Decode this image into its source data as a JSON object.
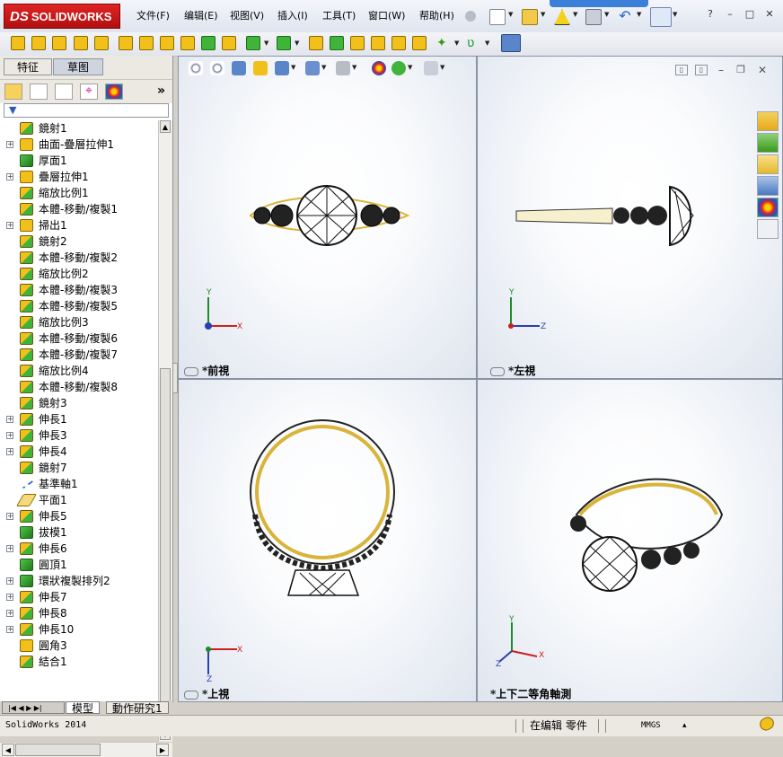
{
  "app": {
    "logo_prefix": "DS",
    "logo_text": "SOLIDWORKS",
    "menu": [
      "文件(F)",
      "编辑(E)",
      "视图(V)",
      "插入(I)",
      "工具(T)",
      "窗口(W)",
      "帮助(H)"
    ],
    "window_controls": [
      "?",
      "–",
      "□",
      "✕"
    ]
  },
  "feature_manager": {
    "tabs": [
      "特征",
      "草图"
    ],
    "active_tab": "草图",
    "more_label": "»",
    "items": [
      {
        "label": "鏡射1",
        "icon": "mirror-icon",
        "expandable": false
      },
      {
        "label": "曲面-疊層拉伸1",
        "icon": "loft-surface-icon",
        "expandable": true
      },
      {
        "label": "厚面1",
        "icon": "thicken-icon",
        "expandable": false
      },
      {
        "label": "疊層拉伸1",
        "icon": "loft-icon",
        "expandable": true
      },
      {
        "label": "縮放比例1",
        "icon": "scale-icon",
        "expandable": false
      },
      {
        "label": "本體-移動/複製1",
        "icon": "move-body-icon",
        "expandable": false
      },
      {
        "label": "掃出1",
        "icon": "sweep-icon",
        "expandable": true
      },
      {
        "label": "鏡射2",
        "icon": "mirror-icon",
        "expandable": false
      },
      {
        "label": "本體-移動/複製2",
        "icon": "move-body-icon",
        "expandable": false
      },
      {
        "label": "縮放比例2",
        "icon": "scale-icon",
        "expandable": false
      },
      {
        "label": "本體-移動/複製3",
        "icon": "move-body-icon",
        "expandable": false
      },
      {
        "label": "本體-移動/複製5",
        "icon": "move-body-icon",
        "expandable": false
      },
      {
        "label": "縮放比例3",
        "icon": "scale-icon",
        "expandable": false
      },
      {
        "label": "本體-移動/複製6",
        "icon": "move-body-icon",
        "expandable": false
      },
      {
        "label": "本體-移動/複製7",
        "icon": "move-body-icon",
        "expandable": false
      },
      {
        "label": "縮放比例4",
        "icon": "scale-icon",
        "expandable": false
      },
      {
        "label": "本體-移動/複製8",
        "icon": "move-body-icon",
        "expandable": false
      },
      {
        "label": "鏡射3",
        "icon": "mirror-icon",
        "expandable": false
      },
      {
        "label": "伸長1",
        "icon": "extrude-icon",
        "expandable": true
      },
      {
        "label": "伸長3",
        "icon": "extrude-icon",
        "expandable": true
      },
      {
        "label": "伸長4",
        "icon": "extrude-icon",
        "expandable": true
      },
      {
        "label": "鏡射7",
        "icon": "mirror-icon",
        "expandable": false
      },
      {
        "label": "基準軸1",
        "icon": "axis-icon",
        "expandable": false
      },
      {
        "label": "平面1",
        "icon": "plane-icon",
        "expandable": false
      },
      {
        "label": "伸長5",
        "icon": "extrude-icon",
        "expandable": true
      },
      {
        "label": "拔模1",
        "icon": "draft-icon",
        "expandable": false
      },
      {
        "label": "伸長6",
        "icon": "extrude-icon",
        "expandable": true
      },
      {
        "label": "圓頂1",
        "icon": "dome-icon",
        "expandable": false
      },
      {
        "label": "環狀複製排列2",
        "icon": "circular-pattern-icon",
        "expandable": true
      },
      {
        "label": "伸長7",
        "icon": "extrude-icon",
        "expandable": true
      },
      {
        "label": "伸長8",
        "icon": "extrude-icon",
        "expandable": true
      },
      {
        "label": "伸長10",
        "icon": "extrude-icon",
        "expandable": true
      },
      {
        "label": "圓角3",
        "icon": "fillet-icon",
        "expandable": false
      },
      {
        "label": "結合1",
        "icon": "combine-icon",
        "expandable": false
      }
    ],
    "bottom_tabs": [
      "模型",
      "動作研究1"
    ]
  },
  "viewports": {
    "front": {
      "label": "*前視"
    },
    "left": {
      "label": "*左視"
    },
    "top": {
      "label": "*上視"
    },
    "iso": {
      "label": "*上下二等角軸測"
    }
  },
  "axes": {
    "x": "X",
    "y": "Y",
    "z": "Z"
  },
  "statusbar": {
    "app_name": "SolidWorks 2014",
    "mode": "在编辑 零件",
    "units": "MMGS",
    "units_caret": "▴"
  },
  "colors": {
    "brand_red": "#c8161b",
    "gold": "#f2c01a",
    "green": "#3fb33a",
    "viewport_bg": "#eef1f6"
  }
}
